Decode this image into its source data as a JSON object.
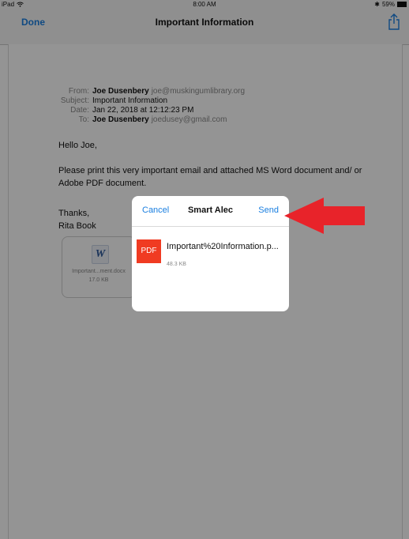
{
  "status_bar": {
    "device": "iPad",
    "time": "8:00 AM",
    "battery": "59%"
  },
  "nav_bar": {
    "done_label": "Done",
    "title": "Important Information"
  },
  "email": {
    "from_label": "From:",
    "from_name": "Joe Dusenbery",
    "from_email": "joe@muskingumlibrary.org",
    "subject_label": "Subject:",
    "subject": "Important Information",
    "date_label": "Date:",
    "date": "Jan 22, 2018 at 12:12:23 PM",
    "to_label": "To:",
    "to_name": "Joe Dusenbery",
    "to_email": "joedusey@gmail.com",
    "greeting": "Hello Joe,",
    "paragraph": "Please print this very important email and attached MS Word document and/ or Adobe PDF document.",
    "signoff_1": "Thanks,",
    "signoff_2": "Rita Book"
  },
  "attachment": {
    "icon_letter": "W",
    "name": "Important...ment.docx",
    "size": "17.0 KB"
  },
  "share_sheet": {
    "cancel_label": "Cancel",
    "title": "Smart Alec",
    "send_label": "Send",
    "file_icon_label": "PDF",
    "file_name": "Important%20Information.p...",
    "file_size": "48.3 KB"
  },
  "colors": {
    "accent": "#1a7fe0",
    "pdf_red": "#f03b22",
    "arrow_red": "#e8232a"
  },
  "icons": {
    "share": "share-icon",
    "wifi": "wifi-icon",
    "bluetooth": "bluetooth-icon",
    "battery": "battery-icon"
  }
}
